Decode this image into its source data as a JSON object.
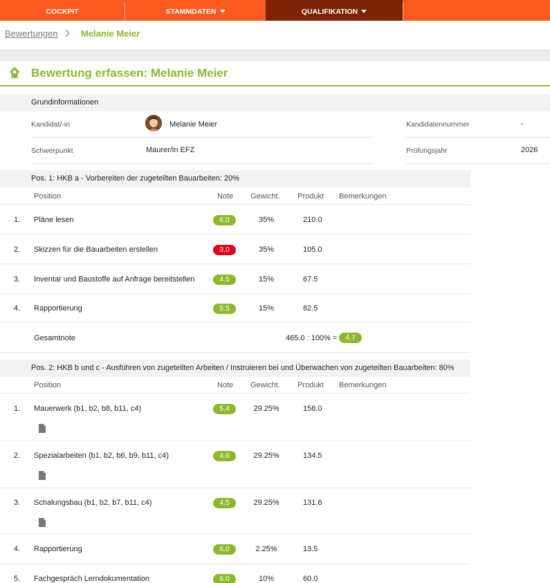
{
  "nav": {
    "items": [
      {
        "label": "COCKPIT"
      },
      {
        "label": "STAMMDATEN"
      },
      {
        "label": "QUALIFIKATION"
      }
    ]
  },
  "breadcrumb": {
    "parent": "Bewertungen",
    "current": "Melanie Meier"
  },
  "page": {
    "title": "Bewertung erfassen: Melanie Meier"
  },
  "grundinfo": {
    "heading": "Grundinformationen",
    "kandidat_label": "Kandidat/-in",
    "kandidat_value": "Melanie Meier",
    "kandidatennummer_label": "Kandidatennummer",
    "kandidatennummer_value": "-",
    "schwerpunkt_label": "Schwerpunkt",
    "schwerpunkt_value": "Maurer/in EFZ",
    "pruefungsjahr_label": "Prüfungsjahr",
    "pruefungsjahr_value": "2026"
  },
  "columns": {
    "position": "Position",
    "note": "Note",
    "gewicht": "Gewicht.",
    "produkt": "Produkt",
    "bemerkungen": "Bemerkungen"
  },
  "pos1": {
    "heading": "Pos. 1: HKB a - Vorbereiten der zugeteilten Bauarbeiten: 20%",
    "rows": [
      {
        "nr": "1.",
        "position": "Pläne lesen",
        "note": "6.0",
        "status": "green",
        "gewicht": "35%",
        "produkt": "210.0"
      },
      {
        "nr": "2.",
        "position": "Skizzen für die Bauarbeiten erstellen",
        "note": "3.0",
        "status": "red",
        "gewicht": "35%",
        "produkt": "105.0"
      },
      {
        "nr": "3.",
        "position": "Inventar und Baustoffe auf Anfrage bereitstellen",
        "note": "4.5",
        "status": "green",
        "gewicht": "15%",
        "produkt": "67.5"
      },
      {
        "nr": "4.",
        "position": "Rapportierung",
        "note": "5.5",
        "status": "green",
        "gewicht": "15%",
        "produkt": "82.5"
      }
    ],
    "gesamt_label": "Gesamtnote",
    "gesamt_calc": "465.0 : 100% =",
    "gesamt_note": "4.7"
  },
  "pos2": {
    "heading": "Pos. 2: HKB b und c - Ausführen von zugeteilten Arbeiten / Instruieren bei und Überwachen von zugeteilten Bauarbeiten: 80%",
    "rows": [
      {
        "nr": "1.",
        "position": "Mauerwerk (b1, b2, b8, b11, c4)",
        "note": "5.4",
        "status": "green",
        "gewicht": "29.25%",
        "produkt": "158.0",
        "doc": true
      },
      {
        "nr": "2.",
        "position": "Spezialarbeiten (b1, b2, b6, b9, b11, c4)",
        "note": "4.6",
        "status": "green",
        "gewicht": "29.25%",
        "produkt": "134.5",
        "doc": true
      },
      {
        "nr": "3.",
        "position": "Schalungsbau (b1, b2, b7, b11, c4)",
        "note": "4.5",
        "status": "green",
        "gewicht": "29.25%",
        "produkt": "131.6",
        "doc": true
      },
      {
        "nr": "4.",
        "position": "Rapportierung",
        "note": "6.0",
        "status": "green",
        "gewicht": "2.25%",
        "produkt": "13.5",
        "doc": false
      },
      {
        "nr": "5.",
        "position": "Fachgespräch Lerndokumentation",
        "note": "6.0",
        "status": "green",
        "gewicht": "10%",
        "produkt": "60.0",
        "doc": false
      }
    ]
  },
  "icons": {
    "title": "badge-award-icon",
    "doc": "document-icon",
    "caret": "caret-down-icon"
  },
  "colors": {
    "nav_bg": "#fb5a1e",
    "nav_active": "#7d2205",
    "accent_green": "#8cb92c",
    "badge_red": "#e2001a"
  }
}
